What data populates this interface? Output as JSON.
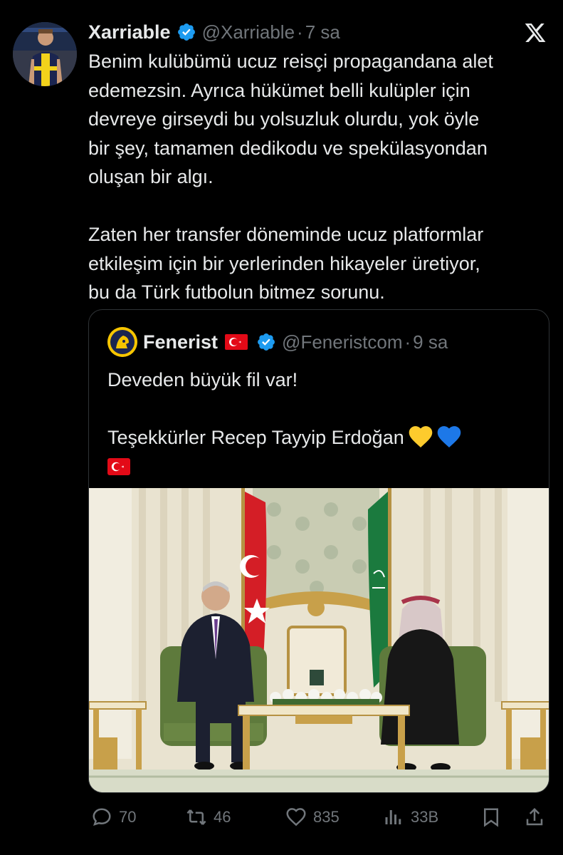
{
  "author": {
    "display_name": "Xarriable",
    "handle": "@Xarriable",
    "separator": "·",
    "time": "7 sa",
    "verified": true
  },
  "tweet_text": "Benim kulübümü ucuz reisçi propagandana alet\nedemezsin. Ayrıca hükümet belli kulüpler için\ndevreye girseydi bu yolsuzluk olurdu, yok öyle\nbir şey, tamamen dedikodu ve spekülasyondan\noluşan bir algı.\n\nZaten her transfer döneminde ucuz platformlar\netkileşim için bir yerlerinden hikayeler üretiyor,\nbu da Türk futbolun bitmez sorunu.",
  "quoted": {
    "display_name": "Fenerist",
    "handle": "@Feneristcom",
    "separator": "·",
    "time": "9 sa",
    "verified": true,
    "text_line_1": "Deveden büyük fil var!",
    "text_line_2": "Teşekkürler Recep Tayyip Erdoğan",
    "icons": [
      "turkey-flag-icon",
      "yellow-heart-icon",
      "blue-heart-icon"
    ]
  },
  "actions": {
    "replies": "70",
    "reposts": "46",
    "likes": "835",
    "views": "33B"
  },
  "colors": {
    "background": "#000000",
    "text": "#e7e9ea",
    "muted": "#71767b",
    "verified_blue": "#1d9bf0",
    "border": "#2f3336"
  }
}
